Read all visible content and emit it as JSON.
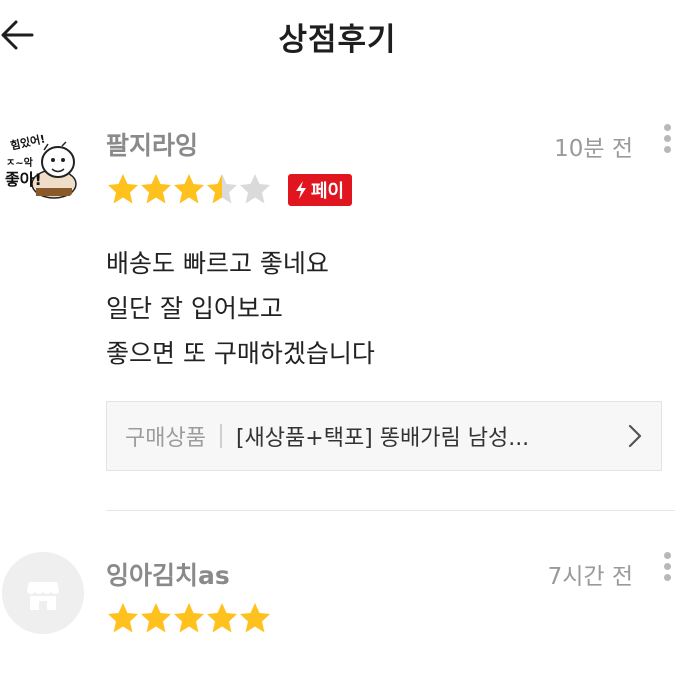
{
  "header": {
    "title": "상점후기",
    "back_icon": "arrow-left-icon"
  },
  "reviews": [
    {
      "username": "팔지라잉",
      "time": "10분 전",
      "rating": 3.5,
      "max_rating": 5,
      "badge": "페이",
      "avatar": {
        "type": "cartoon-sticker",
        "text_top": "힘있어!",
        "text_mid": "ㅈ~악",
        "text_big": "좋아!"
      },
      "text_lines": [
        "배송도 빠르고 좋네요",
        "일단 잘 입어보고",
        "좋으면 또 구매하겠습니다"
      ],
      "product": {
        "label": "구매상품",
        "name": "[새상품+택포] 똥배가림 남성..."
      }
    },
    {
      "username": "잉아김치as",
      "time": "7시간 전",
      "rating": 5,
      "max_rating": 5,
      "avatar": {
        "type": "default-shop-icon"
      }
    }
  ],
  "colors": {
    "star": "#FFC11E",
    "star_empty": "#DADADA",
    "pay_badge": "#E0151F",
    "username": "#8A8A8A"
  }
}
